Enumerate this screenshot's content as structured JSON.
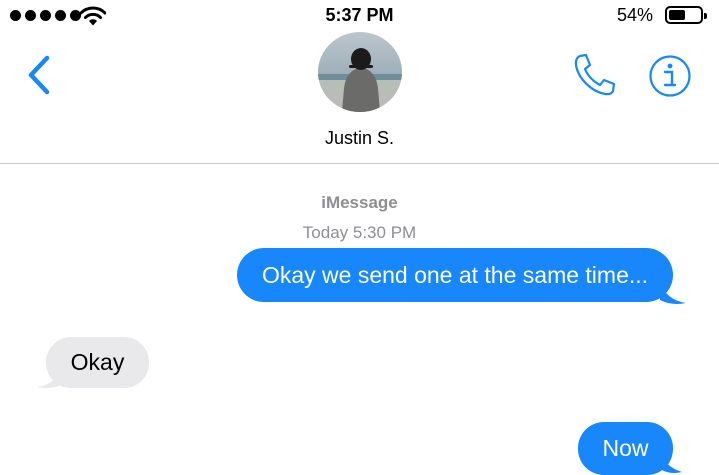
{
  "status_bar": {
    "time": "5:37 PM",
    "battery_percent": "54%",
    "battery_level": 0.54,
    "signal_dots": 5,
    "signal_icon": "cellular-dots-icon",
    "wifi_icon": "wifi-icon"
  },
  "header": {
    "contact_name": "Justin S.",
    "back_icon": "chevron-left-icon",
    "call_icon": "phone-icon",
    "info_icon": "info-icon",
    "accent_color": "#1787fb"
  },
  "conversation": {
    "service": "iMessage",
    "timestamp": "Today 5:30 PM",
    "messages": [
      {
        "direction": "sent",
        "text": "Okay we send one at the same time..."
      },
      {
        "direction": "received",
        "text": "Okay"
      },
      {
        "direction": "sent",
        "text": "Now"
      }
    ],
    "colors": {
      "sent_bubble": "#1787fb",
      "received_bubble": "#e9e9eb",
      "meta_text": "#8e8e93"
    }
  }
}
